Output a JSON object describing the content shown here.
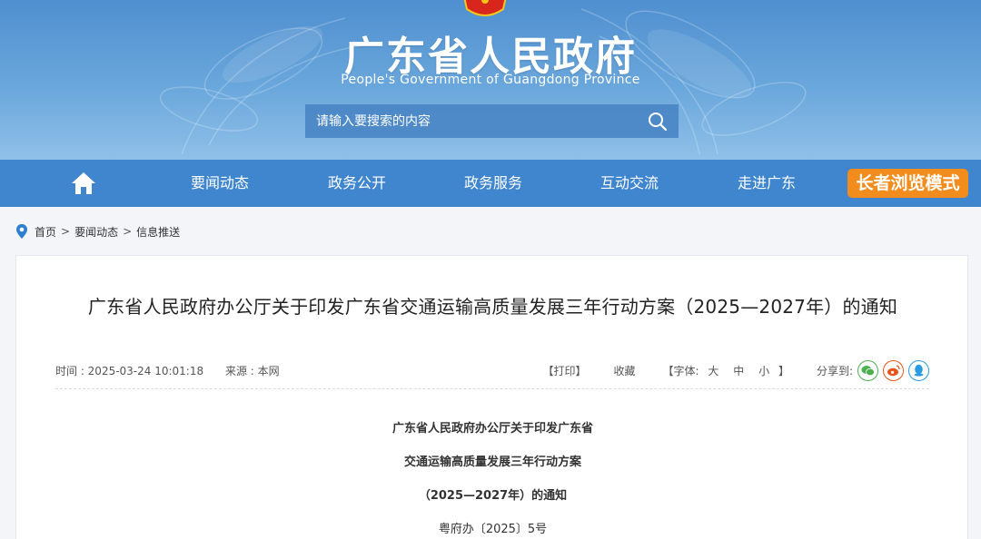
{
  "header": {
    "title": "广东省人民政府",
    "subtitle": "People's Government of Guangdong Province",
    "search_placeholder": "请输入要搜索的内容"
  },
  "nav": {
    "items": [
      "要闻动态",
      "政务公开",
      "政务服务",
      "互动交流",
      "走进广东"
    ],
    "elder_mode": "长者浏览模式"
  },
  "breadcrumb": {
    "items": [
      "首页",
      "要闻动态",
      "信息推送"
    ],
    "separator": ">"
  },
  "article": {
    "title": "广东省人民政府办公厅关于印发广东省交通运输高质量发展三年行动方案（2025—2027年）的通知",
    "time": "时间 : 2025-03-24 10:01:18",
    "source": "来源 : 本网",
    "print": "【打印】",
    "favorite": "收藏",
    "font_prefix": "【字体:",
    "font_large": "大",
    "font_medium": "中",
    "font_small": "小",
    "font_suffix": "】",
    "share_label": "分享到:",
    "body_lines": [
      "广东省人民政府办公厅关于印发广东省",
      "交通运输高质量发展三年行动方案",
      "（2025—2027年）的通知",
      "粤府办〔2025〕5号"
    ]
  },
  "colors": {
    "nav_bg": "#3f86cf",
    "elder_btn": "#f28c1c",
    "wechat": "#4caf50",
    "weibo": "#e8541c",
    "qq": "#2b9be0"
  },
  "icons": [
    "emblem-icon",
    "search-icon",
    "home-icon",
    "location-pin-icon",
    "wechat-icon",
    "weibo-icon",
    "qq-icon"
  ]
}
